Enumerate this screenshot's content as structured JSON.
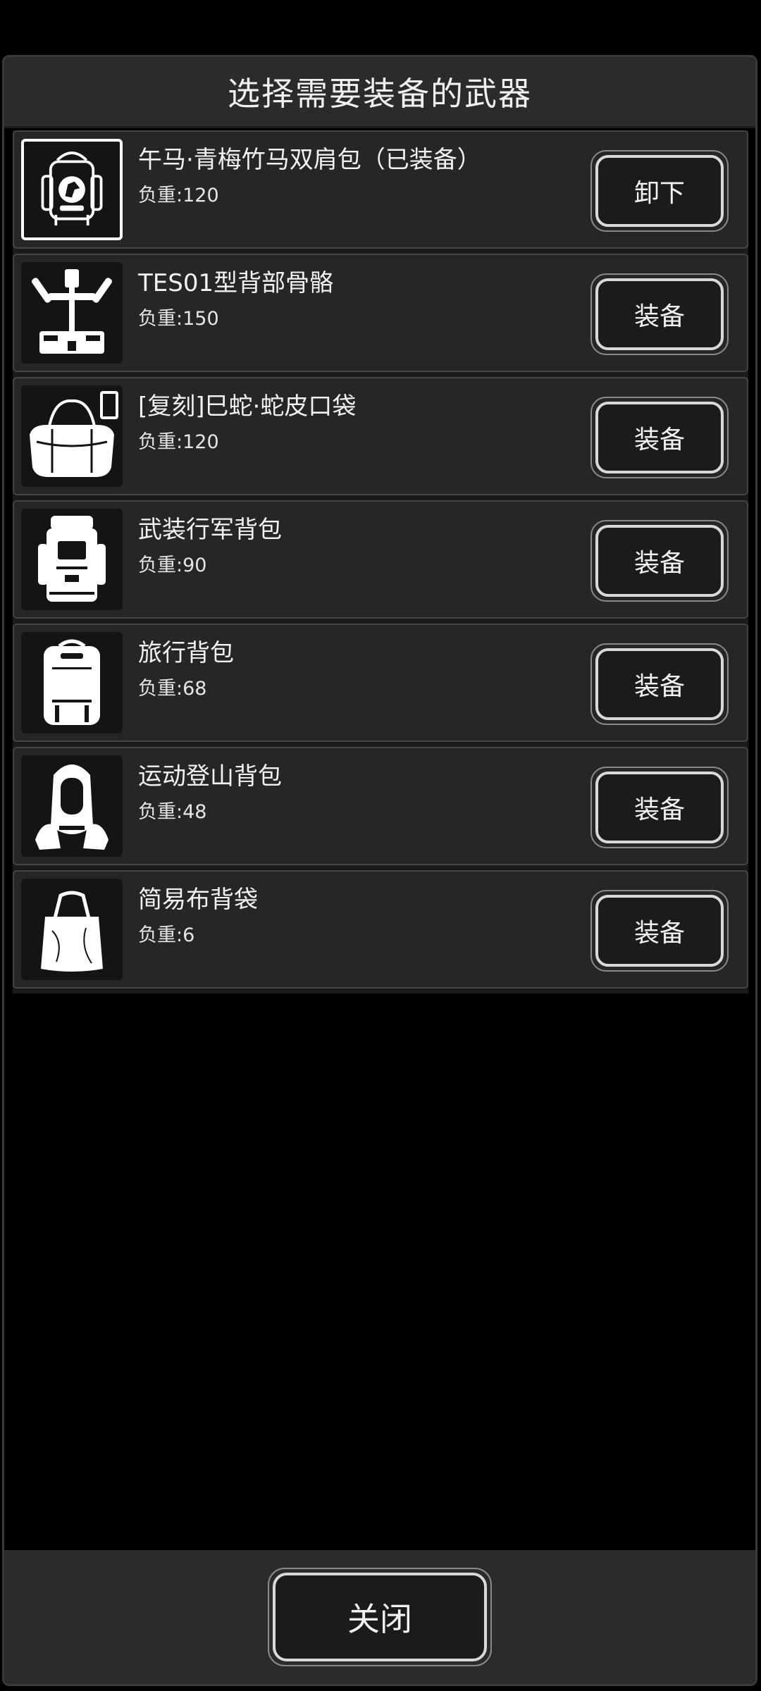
{
  "dialog": {
    "title": "选择需要装备的武器",
    "close_label": "关闭"
  },
  "items": [
    {
      "name": "午马·青梅竹马双肩包（已装备）",
      "weight": "负重:120",
      "action": "卸下",
      "icon": "backpack-horse-icon",
      "equipped": true
    },
    {
      "name": "TES01型背部骨骼",
      "weight": "负重:150",
      "action": "装备",
      "icon": "exoskeleton-frame-icon",
      "equipped": false
    },
    {
      "name": "[复刻]巳蛇·蛇皮口袋",
      "weight": "负重:120",
      "action": "装备",
      "icon": "duffel-bag-icon",
      "badge": "复刻",
      "equipped": false
    },
    {
      "name": "武装行军背包",
      "weight": "负重:90",
      "action": "装备",
      "icon": "military-backpack-icon",
      "equipped": false
    },
    {
      "name": "旅行背包",
      "weight": "负重:68",
      "action": "装备",
      "icon": "travel-backpack-icon",
      "equipped": false
    },
    {
      "name": "运动登山背包",
      "weight": "负重:48",
      "action": "装备",
      "icon": "hiking-backpack-icon",
      "equipped": false
    },
    {
      "name": "简易布背袋",
      "weight": "负重:6",
      "action": "装备",
      "icon": "tote-bag-icon",
      "equipped": false
    }
  ]
}
